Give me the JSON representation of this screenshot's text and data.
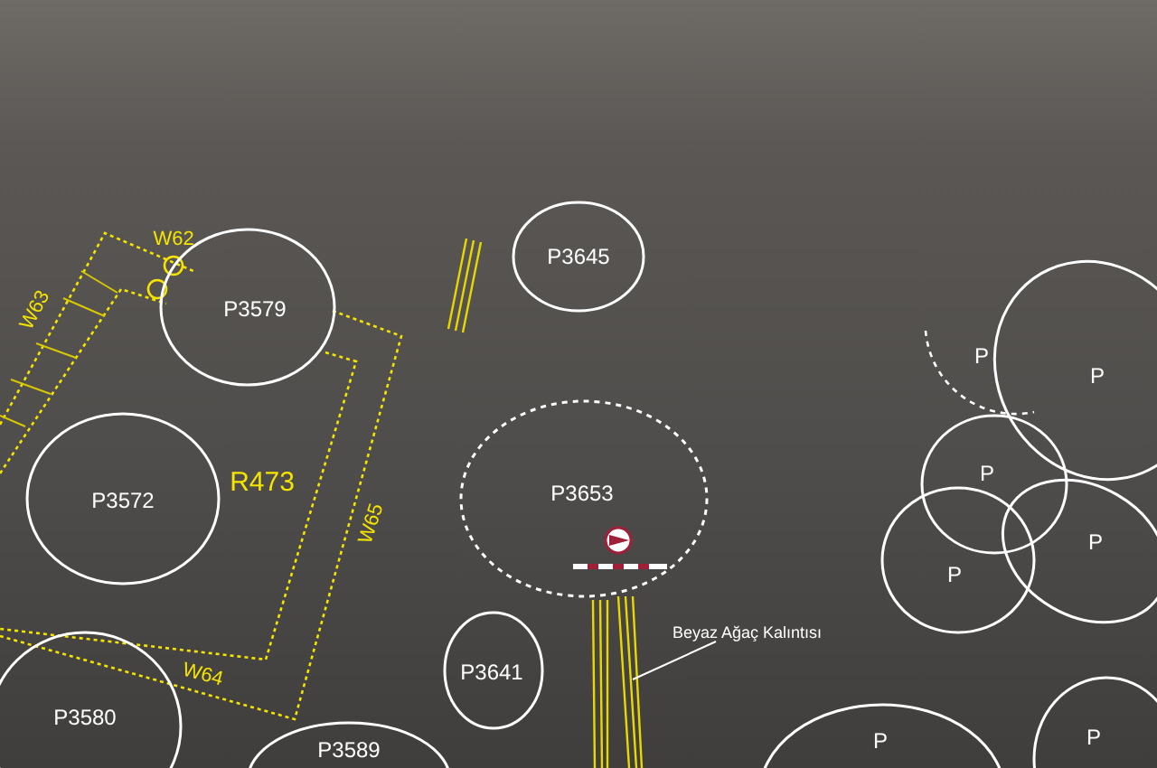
{
  "room": {
    "label": "R473"
  },
  "walls": [
    {
      "label": "W62"
    },
    {
      "label": "W63"
    },
    {
      "label": "W64"
    },
    {
      "label": "W65"
    }
  ],
  "pits": [
    {
      "label": "P3645",
      "dashed": false
    },
    {
      "label": "P3579",
      "dashed": false
    },
    {
      "label": "P3572",
      "dashed": false
    },
    {
      "label": "P3653",
      "dashed": true
    },
    {
      "label": "P3641",
      "dashed": false
    },
    {
      "label": "P3580",
      "dashed": false
    },
    {
      "label": "P3589",
      "dashed": false
    },
    {
      "label": "P",
      "dashed": true
    },
    {
      "label": "P",
      "dashed": false
    },
    {
      "label": "P",
      "dashed": false
    },
    {
      "label": "P",
      "dashed": false
    },
    {
      "label": "P",
      "dashed": false
    },
    {
      "label": "P",
      "dashed": false
    },
    {
      "label": "P",
      "dashed": false
    }
  ],
  "annotation": {
    "label": "Beyaz Ağaç Kalıntısı"
  }
}
